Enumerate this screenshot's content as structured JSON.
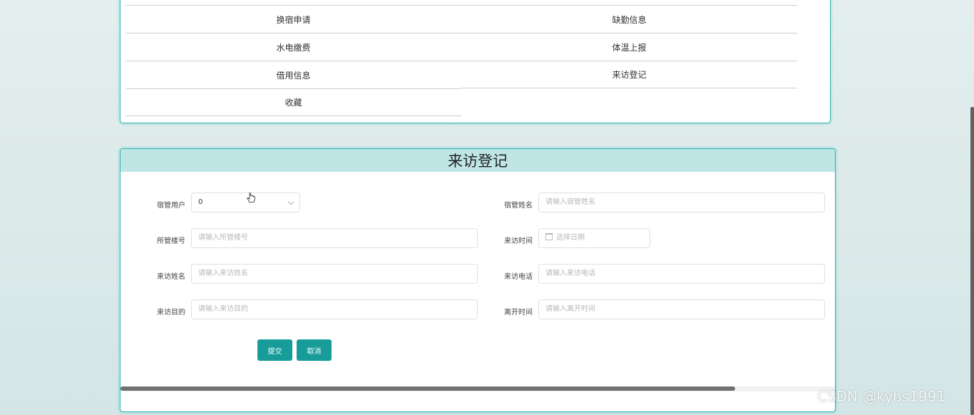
{
  "menu": {
    "items": [
      "换宿申请",
      "缺勤信息",
      "水电缴费",
      "体温上报",
      "借用信息",
      "来访登记",
      "收藏"
    ]
  },
  "form": {
    "title": "来访登记",
    "fields": {
      "dorm_user": {
        "label": "宿管用户",
        "value": "0"
      },
      "dorm_name": {
        "label": "宿管姓名",
        "placeholder": "请输入宿管姓名"
      },
      "building_no": {
        "label": "所管楼号",
        "placeholder": "请输入所管楼号"
      },
      "visit_time": {
        "label": "来访时间",
        "placeholder": "选择日期"
      },
      "visitor_name": {
        "label": "来访姓名",
        "placeholder": "请输入来访姓名"
      },
      "visitor_phone": {
        "label": "来访电话",
        "placeholder": "请输入来访电话"
      },
      "visit_purpose": {
        "label": "来访目的",
        "placeholder": "请输入来访目的"
      },
      "leave_time": {
        "label": "离开时间",
        "placeholder": "请输入离开时间"
      }
    },
    "submit_label": "提交",
    "cancel_label": "取消"
  },
  "watermark": "CSDN @kybs1991",
  "colors": {
    "accent": "#179c9a",
    "header_bg": "#bfe5e5",
    "border": "#2bb7b3"
  }
}
